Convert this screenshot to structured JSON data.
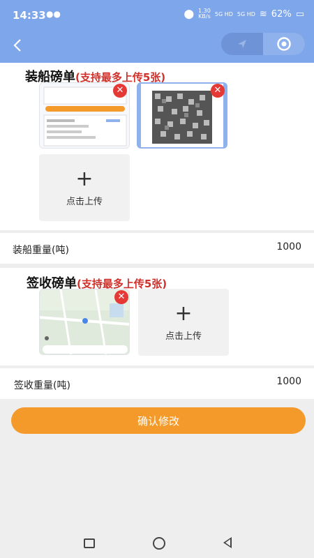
{
  "status": {
    "time": "14:33",
    "net_speed_value": "1.30",
    "net_speed_unit": "KB/s",
    "sim1": "5G HD",
    "sim2": "5G HD",
    "battery": "62%"
  },
  "loading_section": {
    "title": "装船磅单",
    "hint": "(支持最多上传5张)",
    "upload_label": "点击上传",
    "weight_label": "装船重量(吨)",
    "weight_value": "1000"
  },
  "receipt_section": {
    "title": "签收磅单",
    "hint": "(支持最多上传5张)",
    "upload_label": "点击上传",
    "weight_label": "签收重量(吨)",
    "weight_value": "1000"
  },
  "confirm_button": "确认修改",
  "colors": {
    "header": "#7ea6ea",
    "accent": "#f49a2b",
    "hint_red": "#d0302a"
  }
}
